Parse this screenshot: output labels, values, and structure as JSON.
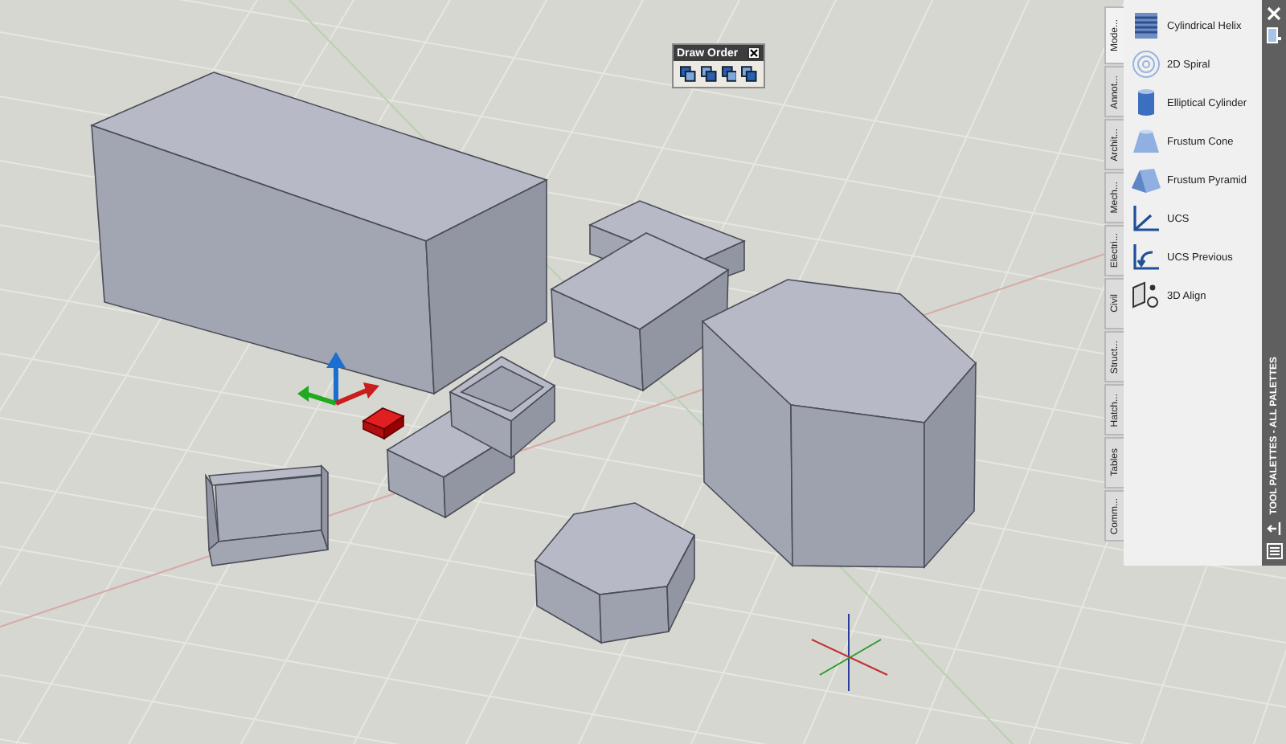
{
  "draw_order_toolbar": {
    "title": "Draw Order"
  },
  "tool_palette": {
    "title": "TOOL PALETTES - ALL PALETTES",
    "tabs": [
      {
        "label": "Mode...",
        "selected": true
      },
      {
        "label": "Annot...",
        "selected": false
      },
      {
        "label": "Archit...",
        "selected": false
      },
      {
        "label": "Mech...",
        "selected": false
      },
      {
        "label": "Electri...",
        "selected": false
      },
      {
        "label": "Civil",
        "selected": false
      },
      {
        "label": "Struct...",
        "selected": false
      },
      {
        "label": "Hatch...",
        "selected": false
      },
      {
        "label": "Tables",
        "selected": false
      },
      {
        "label": "Comm...",
        "selected": false
      }
    ],
    "items": [
      {
        "label": "Cylindrical Helix"
      },
      {
        "label": "2D Spiral"
      },
      {
        "label": "Elliptical Cylinder"
      },
      {
        "label": "Frustum Cone"
      },
      {
        "label": "Frustum Pyramid"
      },
      {
        "label": "UCS"
      },
      {
        "label": "UCS Previous"
      },
      {
        "label": "3D Align"
      }
    ]
  }
}
